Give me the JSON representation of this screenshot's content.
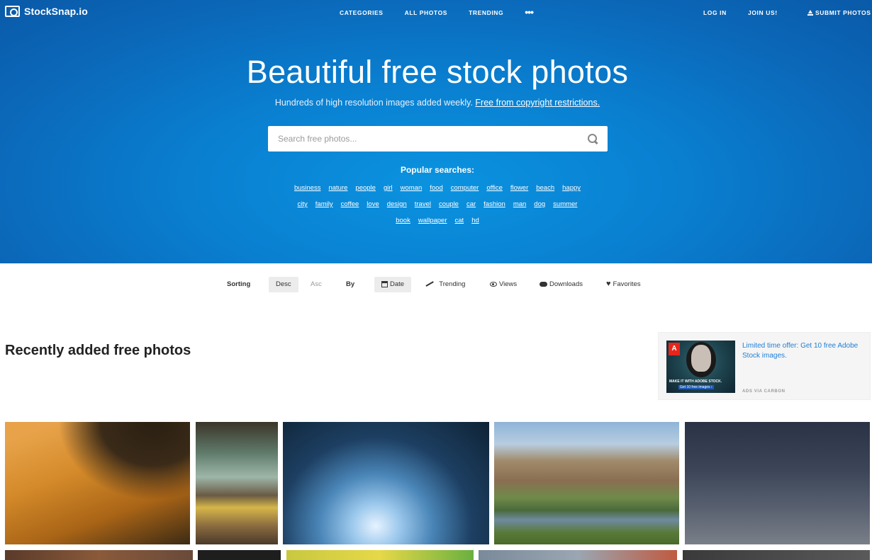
{
  "brand": {
    "name": "StockSnap.io"
  },
  "nav": {
    "categories": "CATEGORIES",
    "all_photos": "ALL PHOTOS",
    "trending": "TRENDING",
    "more": "•••",
    "login": "LOG IN",
    "join": "JOIN US!",
    "submit": "SUBMIT PHOTOS"
  },
  "hero": {
    "title": "Beautiful free stock photos",
    "subtitle": "Hundreds of high resolution images added weekly.",
    "subtitle_link": "Free from copyright restrictions."
  },
  "search": {
    "placeholder": "Search free photos..."
  },
  "popular": {
    "title": "Popular searches:",
    "row1": [
      "business",
      "nature",
      "people",
      "girl",
      "woman",
      "food",
      "computer",
      "office",
      "flower",
      "beach",
      "happy"
    ],
    "row2": [
      "city",
      "family",
      "coffee",
      "love",
      "design",
      "travel",
      "couple",
      "car",
      "fashion",
      "man",
      "dog",
      "summer"
    ],
    "row3": [
      "book",
      "wallpaper",
      "cat",
      "hd"
    ]
  },
  "sorting": {
    "label": "Sorting",
    "desc": "Desc",
    "asc": "Asc",
    "by": "By",
    "date": "Date",
    "trending": "Trending",
    "views": "Views",
    "downloads": "Downloads",
    "favorites": "Favorites"
  },
  "section": {
    "title": "Recently added free photos"
  },
  "ad": {
    "text": "Limited time offer: Get 10 free Adobe Stock images.",
    "via": "ADS VIA CARBON",
    "image_logo": "A",
    "image_tagline": "MAKE IT WITH ADOBE STOCK.",
    "image_cta": "Get 10 free images ›"
  },
  "colors": {
    "hero_blue": "#0a7fd0",
    "link_blue": "#1e7fd6",
    "adobe_red": "#e8251b"
  }
}
